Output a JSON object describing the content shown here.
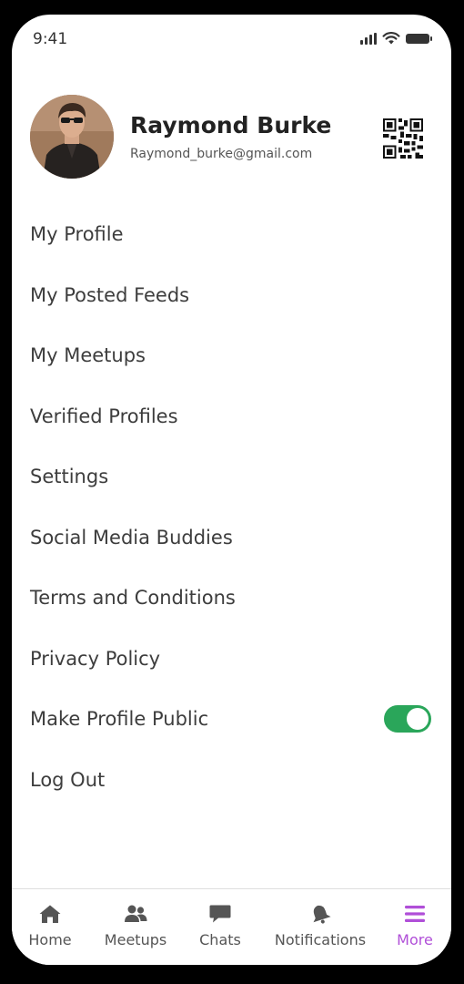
{
  "status_bar": {
    "time": "9:41"
  },
  "profile": {
    "name": "Raymond Burke",
    "email": "Raymond_burke@gmail.com"
  },
  "menu": {
    "items": [
      {
        "label": "My Profile"
      },
      {
        "label": "My Posted Feeds"
      },
      {
        "label": "My Meetups"
      },
      {
        "label": "Verified Profiles"
      },
      {
        "label": "Settings"
      },
      {
        "label": "Social Media Buddies"
      },
      {
        "label": "Terms and Conditions"
      },
      {
        "label": "Privacy Policy"
      },
      {
        "label": "Make Profile Public",
        "toggle": true
      },
      {
        "label": "Log Out"
      }
    ]
  },
  "tab_bar": {
    "tabs": [
      {
        "label": "Home",
        "icon": "home-icon"
      },
      {
        "label": "Meetups",
        "icon": "people-icon"
      },
      {
        "label": "Chats",
        "icon": "chat-bubble-icon"
      },
      {
        "label": "Notifications",
        "icon": "bell-icon"
      },
      {
        "label": "More",
        "icon": "menu-icon",
        "active": true
      }
    ]
  },
  "colors": {
    "accent": "#b04fd8",
    "toggle_on": "#2aa65a",
    "text": "#3d3d3d"
  }
}
